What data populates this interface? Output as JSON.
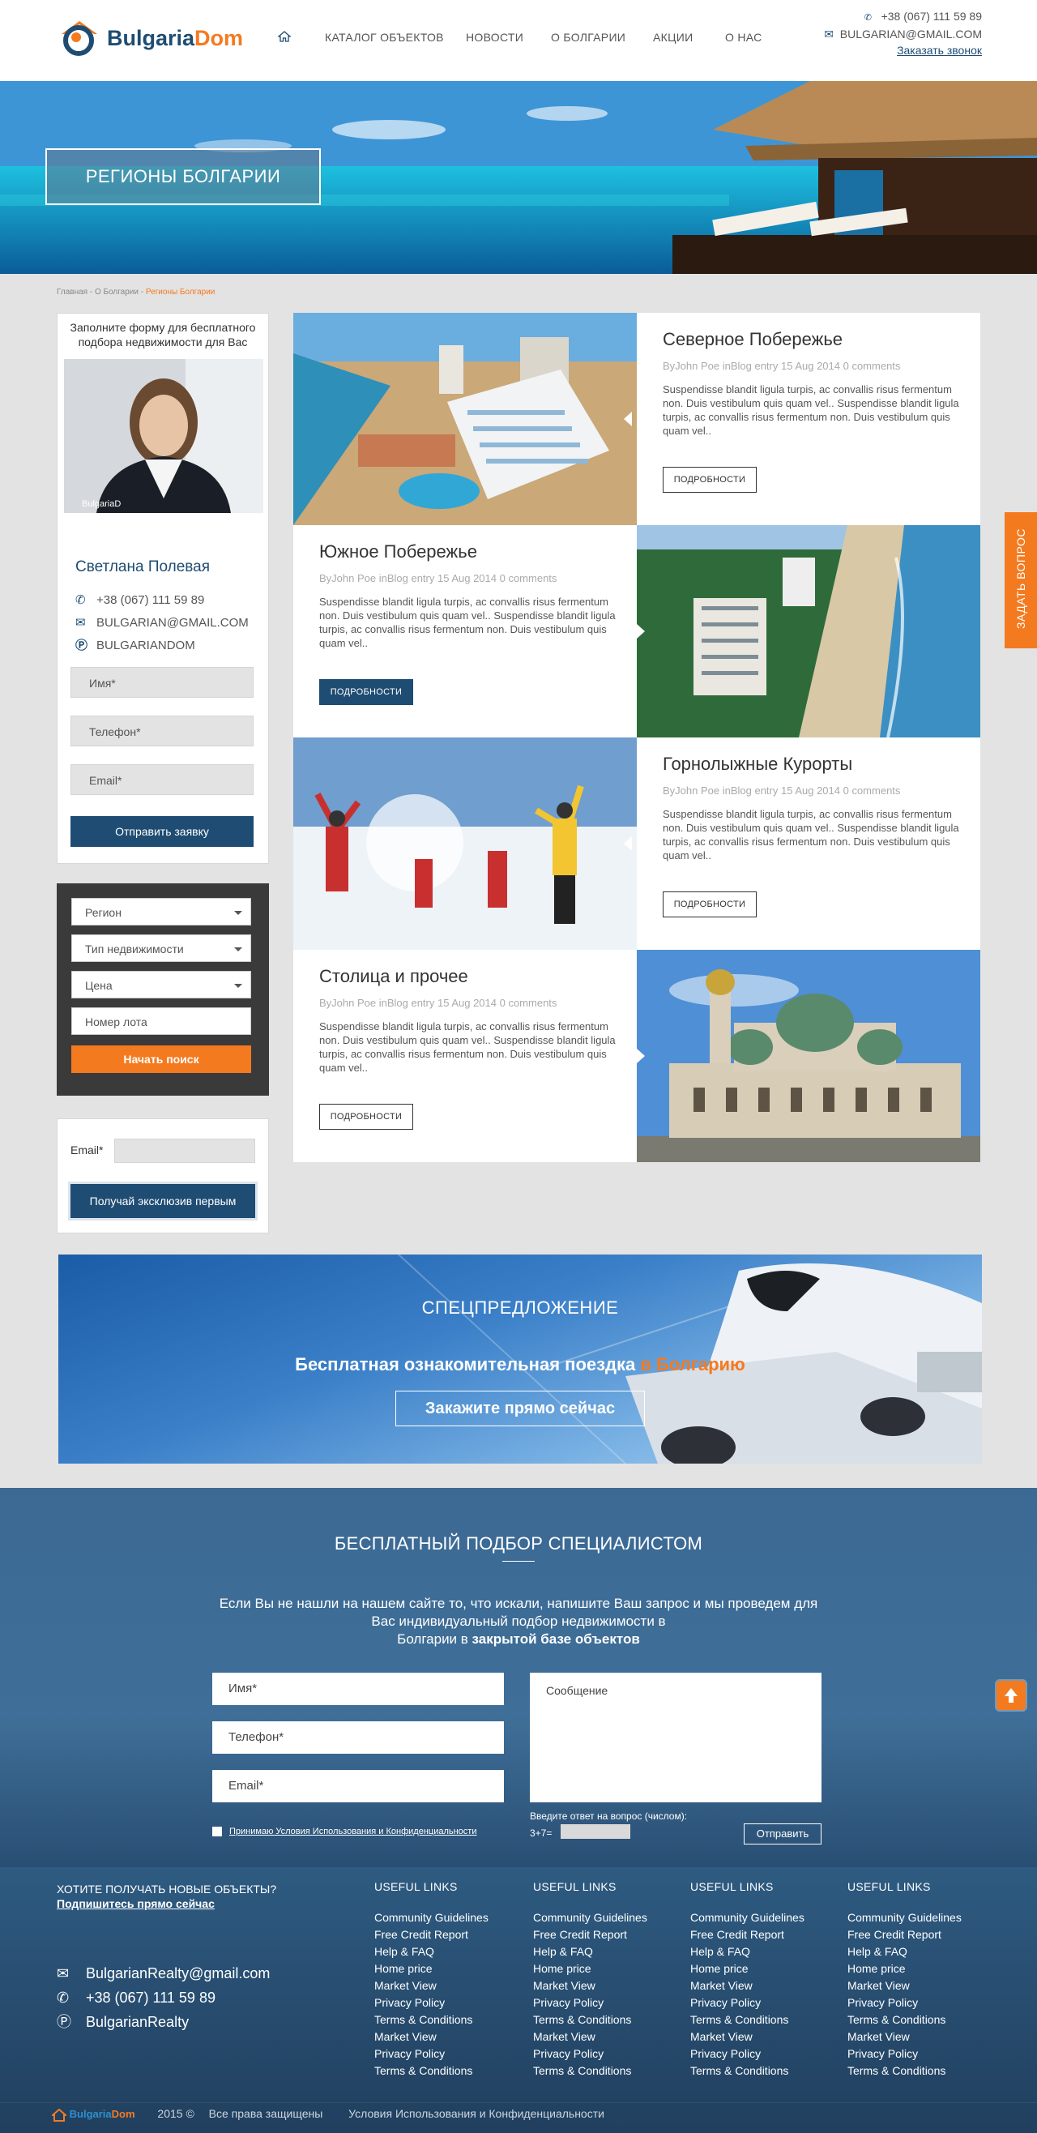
{
  "header": {
    "brand_part1": "Bulgaria",
    "brand_part2": "Dom",
    "nav": [
      "КАТАЛОГ ОБЪЕКТОВ",
      "НОВОСТИ",
      "О БОЛГАРИИ",
      "АКЦИИ",
      "О НАС"
    ],
    "phone": "+38 (067) 111 59 89",
    "email": "BULGARIAN@GMAIL.COM",
    "callback": "Заказать звонок"
  },
  "hero": {
    "title": "РЕГИОНЫ БОЛГАРИИ"
  },
  "breadcrumb": {
    "path": "Главная - О Болгарии - ",
    "current": "Регионы Болгарии"
  },
  "agent": {
    "intro": "Заполните форму для бесплатного подбора недвижимости для Вас",
    "name": "Светлана Полевая",
    "phone": "+38 (067) 111 59 89",
    "email": "BULGARIAN@GMAIL.COM",
    "skype": "BULGARIANDOM",
    "photo_watermark": "BulgariaD",
    "fields": [
      "Имя*",
      "Телефон*",
      "Email*"
    ],
    "submit": "Отправить заявку"
  },
  "search": {
    "selects": [
      "Регион",
      "Тип недвижимости",
      "Цена"
    ],
    "lot_placeholder": "Номер лота",
    "submit": "Начать поиск"
  },
  "subscribe": {
    "label": "Email*",
    "button": "Получай эксклюзив первым"
  },
  "articles": [
    {
      "title": "Северное Побережье",
      "meta": "ByJohn Poe inBlog entry 15 Aug 2014 0 comments",
      "desc": "Suspendisse blandit ligula turpis, ac convallis risus fermentum non. Duis vestibulum quis quam vel.. Suspendisse blandit ligula turpis, ac convallis risus fermentum non. Duis vestibulum quis quam vel..",
      "more": "ПОДРОБНОСТИ"
    },
    {
      "title": "Южное Побережье",
      "meta": "ByJohn Poe inBlog entry 15 Aug 2014 0 comments",
      "desc": "Suspendisse blandit ligula turpis, ac convallis risus fermentum non. Duis vestibulum quis quam vel.. Suspendisse blandit ligula turpis, ac convallis risus fermentum non. Duis vestibulum quis quam vel..",
      "more": "ПОДРОБНОСТИ"
    },
    {
      "title": "Горнолыжные Курорты",
      "meta": "ByJohn Poe inBlog entry 15 Aug 2014 0 comments",
      "desc": "Suspendisse blandit ligula turpis, ac convallis risus fermentum non. Duis vestibulum quis quam vel.. Suspendisse blandit ligula turpis, ac convallis risus fermentum non. Duis vestibulum quis quam vel..",
      "more": "ПОДРОБНОСТИ"
    },
    {
      "title": "Столица и прочее",
      "meta": "ByJohn Poe inBlog entry 15 Aug 2014 0 comments",
      "desc": "Suspendisse blandit ligula turpis, ac convallis risus fermentum non. Duis vestibulum quis quam vel.. Suspendisse blandit ligula turpis, ac convallis risus fermentum non. Duis vestibulum quis quam vel..",
      "more": "ПОДРОБНОСТИ"
    }
  ],
  "side_tab": "ЗАДАТЬ ВОПРОС",
  "promo": {
    "title": "СПЕЦПРЕДЛОЖЕНИЕ",
    "line_part1": "Бесплатная ознакомительная поездка ",
    "line_part2": "в Болгарию",
    "cta": "Закажите прямо сейчас"
  },
  "selection": {
    "title": "БЕСПЛАТНЫЙ ПОДБОР СПЕЦИАЛИСТОМ",
    "text_line1": "Если Вы не нашли на нашем сайте то, что искали, напишите Ваш запрос и мы проведем для",
    "text_line2": "Вас индивидуальный подбор недвижимости в",
    "text_line3_part1": "Болгарии в ",
    "text_line3_part2": "закрытой базе объектов",
    "fields": [
      "Имя*",
      "Телефон*",
      "Email*"
    ],
    "message": "Сообщение",
    "captcha_label": "Введите ответ на вопрос (числом):",
    "captcha_q": "3+7=",
    "agree": "Принимаю Условия Использования и Конфиденциальности",
    "send": "Отправить"
  },
  "footer": {
    "cta_line1": "ХОТИТЕ ПОЛУЧАТЬ НОВЫЕ ОБЪЕКТЫ?",
    "cta_line2": "Подпишитесь прямо сейчас",
    "email": "BulgarianRealty@gmail.com",
    "phone": "+38 (067) 111 59 89",
    "skype": "BulgarianRealty",
    "columns": [
      {
        "heading": "USEFUL LINKS",
        "links": [
          "Community Guidelines",
          "Free Credit Report",
          "Help & FAQ",
          "Home price",
          "Market View",
          "Privacy Policy",
          "Terms & Conditions",
          "Market View",
          "Privacy Policy",
          "Terms & Conditions"
        ]
      },
      {
        "heading": "USEFUL LINKS",
        "links": [
          "Community Guidelines",
          "Free Credit Report",
          "Help & FAQ",
          "Home price",
          "Market View",
          "Privacy Policy",
          "Terms & Conditions",
          "Market View",
          "Privacy Policy",
          "Terms & Conditions"
        ]
      },
      {
        "heading": "USEFUL LINKS",
        "links": [
          "Community Guidelines",
          "Free Credit Report",
          "Help & FAQ",
          "Home price",
          "Market View",
          "Privacy Policy",
          "Terms & Conditions",
          "Market View",
          "Privacy Policy",
          "Terms & Conditions"
        ]
      },
      {
        "heading": "USEFUL LINKS",
        "links": [
          "Community Guidelines",
          "Free Credit Report",
          "Help & FAQ",
          "Home price",
          "Market View",
          "Privacy Policy",
          "Terms & Conditions",
          "Market View",
          "Privacy Policy",
          "Terms & Conditions"
        ]
      }
    ],
    "brand_part1": "Bulgaria",
    "brand_part2": "Dom",
    "year": "2015 ©",
    "rights": "Все права защищены",
    "terms": "Условия Использования и Конфиденциальности"
  },
  "colors": {
    "brand_blue": "#1f4c72",
    "accent_orange": "#f47a20",
    "page_bg": "#e3e3e3"
  }
}
